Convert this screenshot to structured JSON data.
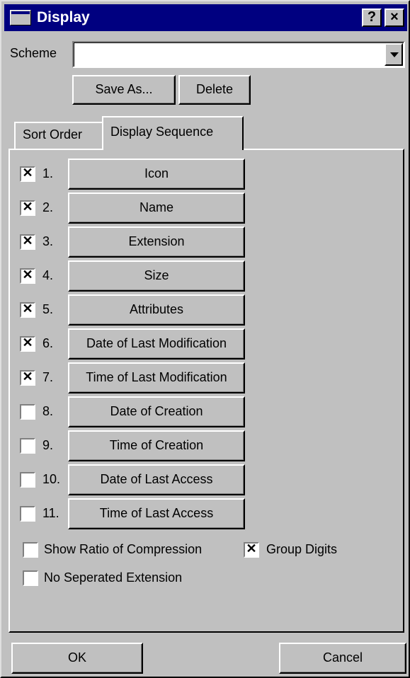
{
  "window": {
    "title": "Display",
    "help_label": "?",
    "close_label": "×"
  },
  "scheme": {
    "label": "Scheme",
    "value": ""
  },
  "buttons": {
    "save_as": "Save As...",
    "delete": "Delete",
    "ok": "OK",
    "cancel": "Cancel"
  },
  "tabs": [
    {
      "label": "Sort Order",
      "active": false
    },
    {
      "label": "Display Sequence",
      "active": true
    }
  ],
  "columns": [
    {
      "num": "1.",
      "label": "Icon",
      "checked": true
    },
    {
      "num": "2.",
      "label": "Name",
      "checked": true
    },
    {
      "num": "3.",
      "label": "Extension",
      "checked": true
    },
    {
      "num": "4.",
      "label": "Size",
      "checked": true
    },
    {
      "num": "5.",
      "label": "Attributes",
      "checked": true
    },
    {
      "num": "6.",
      "label": "Date of Last Modification",
      "checked": true
    },
    {
      "num": "7.",
      "label": "Time of Last Modification",
      "checked": true
    },
    {
      "num": "8.",
      "label": "Date of Creation",
      "checked": false
    },
    {
      "num": "9.",
      "label": "Time of Creation",
      "checked": false
    },
    {
      "num": "10.",
      "label": "Date of Last Access",
      "checked": false
    },
    {
      "num": "11.",
      "label": "Time of Last Access",
      "checked": false
    }
  ],
  "options": {
    "show_ratio": {
      "label": "Show Ratio of Compression",
      "checked": false
    },
    "group_digits": {
      "label": "Group Digits",
      "checked": true
    },
    "no_separated_ext": {
      "label": "No Seperated Extension",
      "checked": false
    }
  },
  "colors": {
    "titlebar": "#000080",
    "face": "#c0c0c0"
  }
}
